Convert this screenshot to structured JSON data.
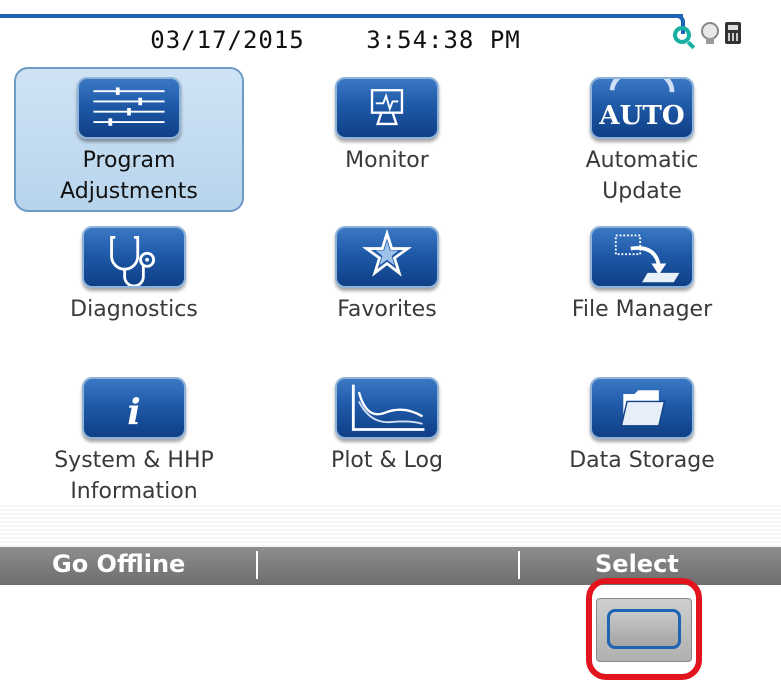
{
  "header": {
    "date": "03/17/2015",
    "time": "3:54:38 PM",
    "status_icons": [
      "connection-icon",
      "bulb-icon",
      "calculator-icon"
    ]
  },
  "menu": {
    "selected": "Program Adjustments",
    "items": [
      {
        "label_line1": "Program",
        "label_line2": "Adjustments",
        "icon": "sliders-icon"
      },
      {
        "label_line1": "Monitor",
        "label_line2": "",
        "icon": "monitor-icon"
      },
      {
        "label_line1": "Automatic",
        "label_line2": "Update",
        "icon": "auto-icon",
        "icon_text": "AUTO"
      },
      {
        "label_line1": "Diagnostics",
        "label_line2": "",
        "icon": "stethoscope-icon"
      },
      {
        "label_line1": "Favorites",
        "label_line2": "",
        "icon": "star-icon"
      },
      {
        "label_line1": "File Manager",
        "label_line2": "",
        "icon": "file-transfer-icon"
      },
      {
        "label_line1": "System & HHP",
        "label_line2": "Information",
        "icon": "info-icon",
        "icon_text": "i"
      },
      {
        "label_line1": "Plot & Log",
        "label_line2": "",
        "icon": "plot-icon"
      },
      {
        "label_line1": "Data Storage",
        "label_line2": "",
        "icon": "folder-icon"
      }
    ]
  },
  "softkeys": {
    "left": "Go Offline",
    "middle": "",
    "right": "Select"
  },
  "colors": {
    "accent": "#1c64b4",
    "highlight": "#e2141d",
    "softkey_bar": "#7a7a7a"
  }
}
